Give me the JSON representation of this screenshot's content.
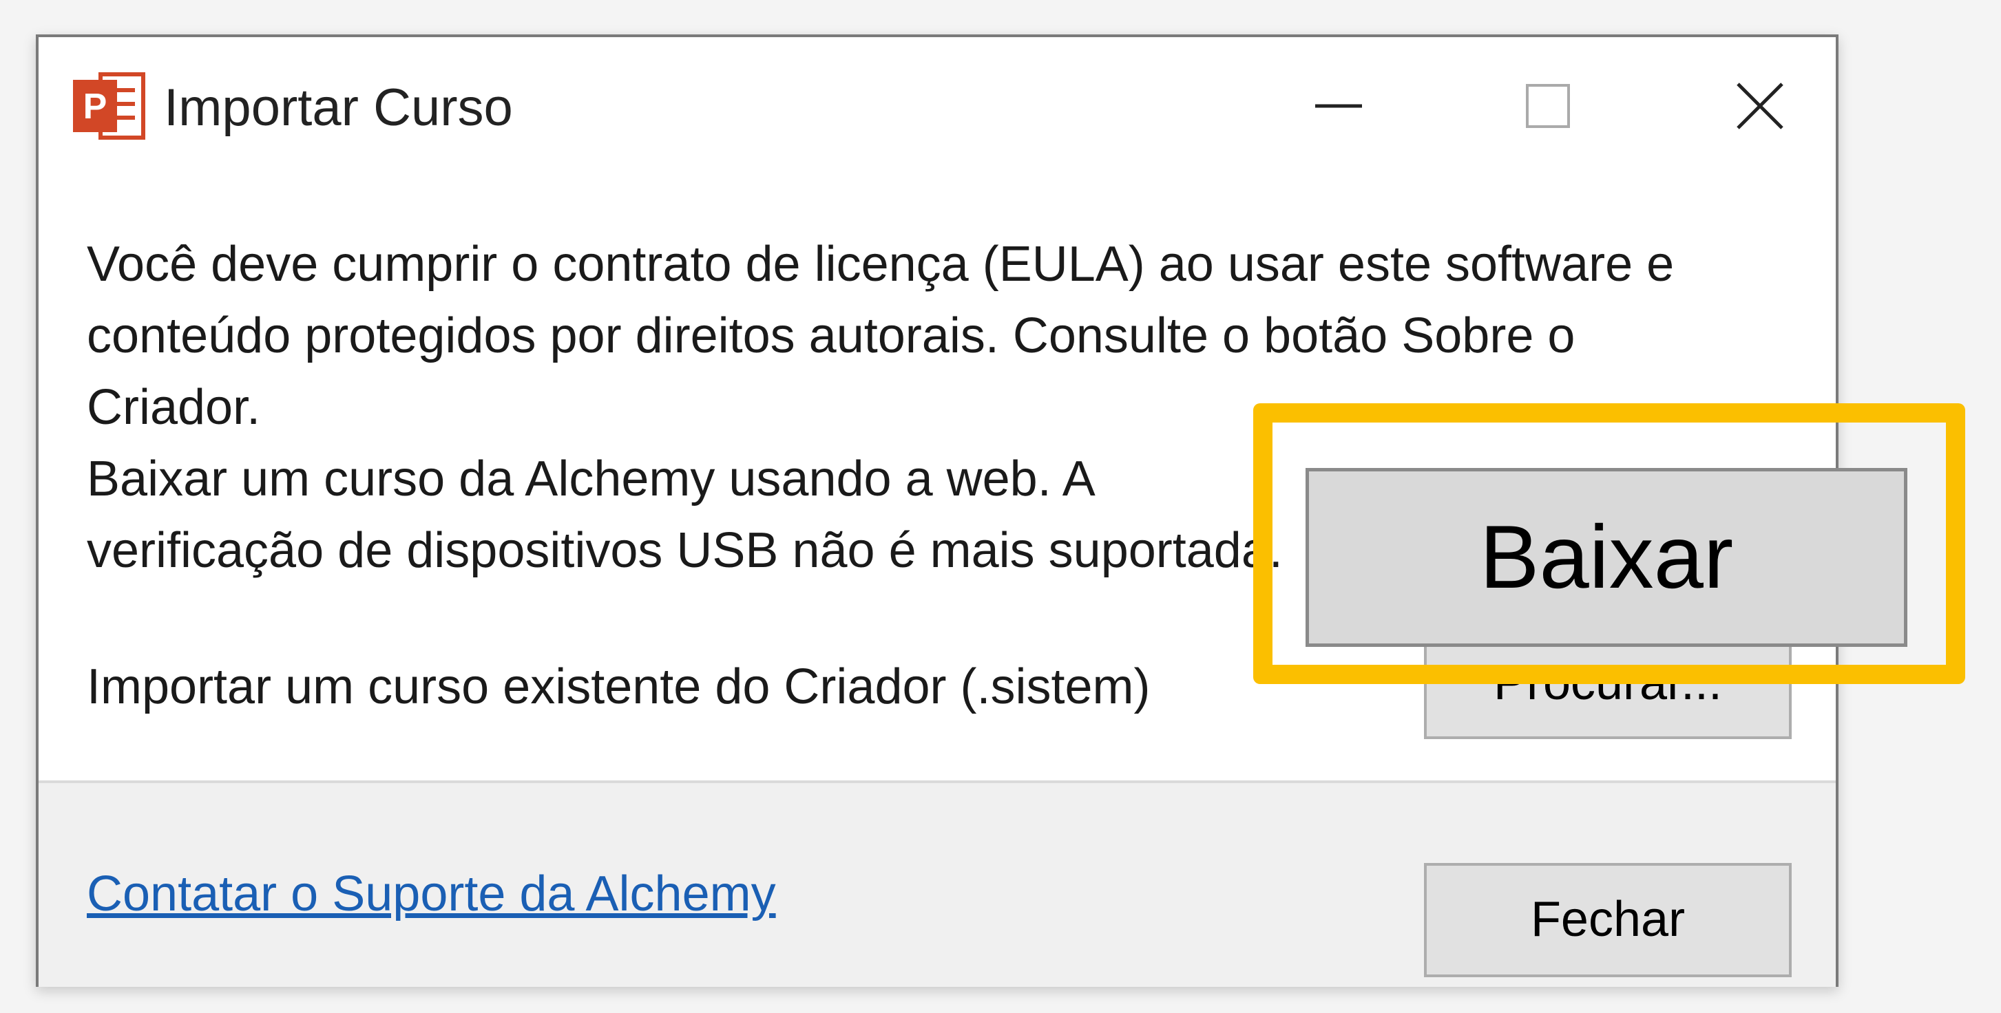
{
  "window": {
    "title": "Importar Curso",
    "app_icon": "powerpoint-icon",
    "controls": {
      "minimize": "minimize-icon",
      "maximize": "maximize-icon",
      "close": "close-icon"
    }
  },
  "content": {
    "eula_lines": [
      "Você deve cumprir o contrato de licença (EULA) ao usar este software e",
      "conteúdo protegidos por direitos autorais. Consulte o botão Sobre o",
      "Criador."
    ],
    "download_lines": [
      "Baixar um curso da Alchemy usando a web. A",
      "verificação de dispositivos USB não é mais suportada."
    ],
    "import_text": "Importar um curso existente do Criador (.sistem)",
    "browse_label": "Procurar...",
    "download_label": "Baixar"
  },
  "footer": {
    "support_link": "Contatar o Suporte da Alchemy",
    "close_label": "Fechar"
  },
  "colors": {
    "highlight": "#fbbf00",
    "link": "#1a5fb4",
    "app_icon": "#d24726"
  }
}
